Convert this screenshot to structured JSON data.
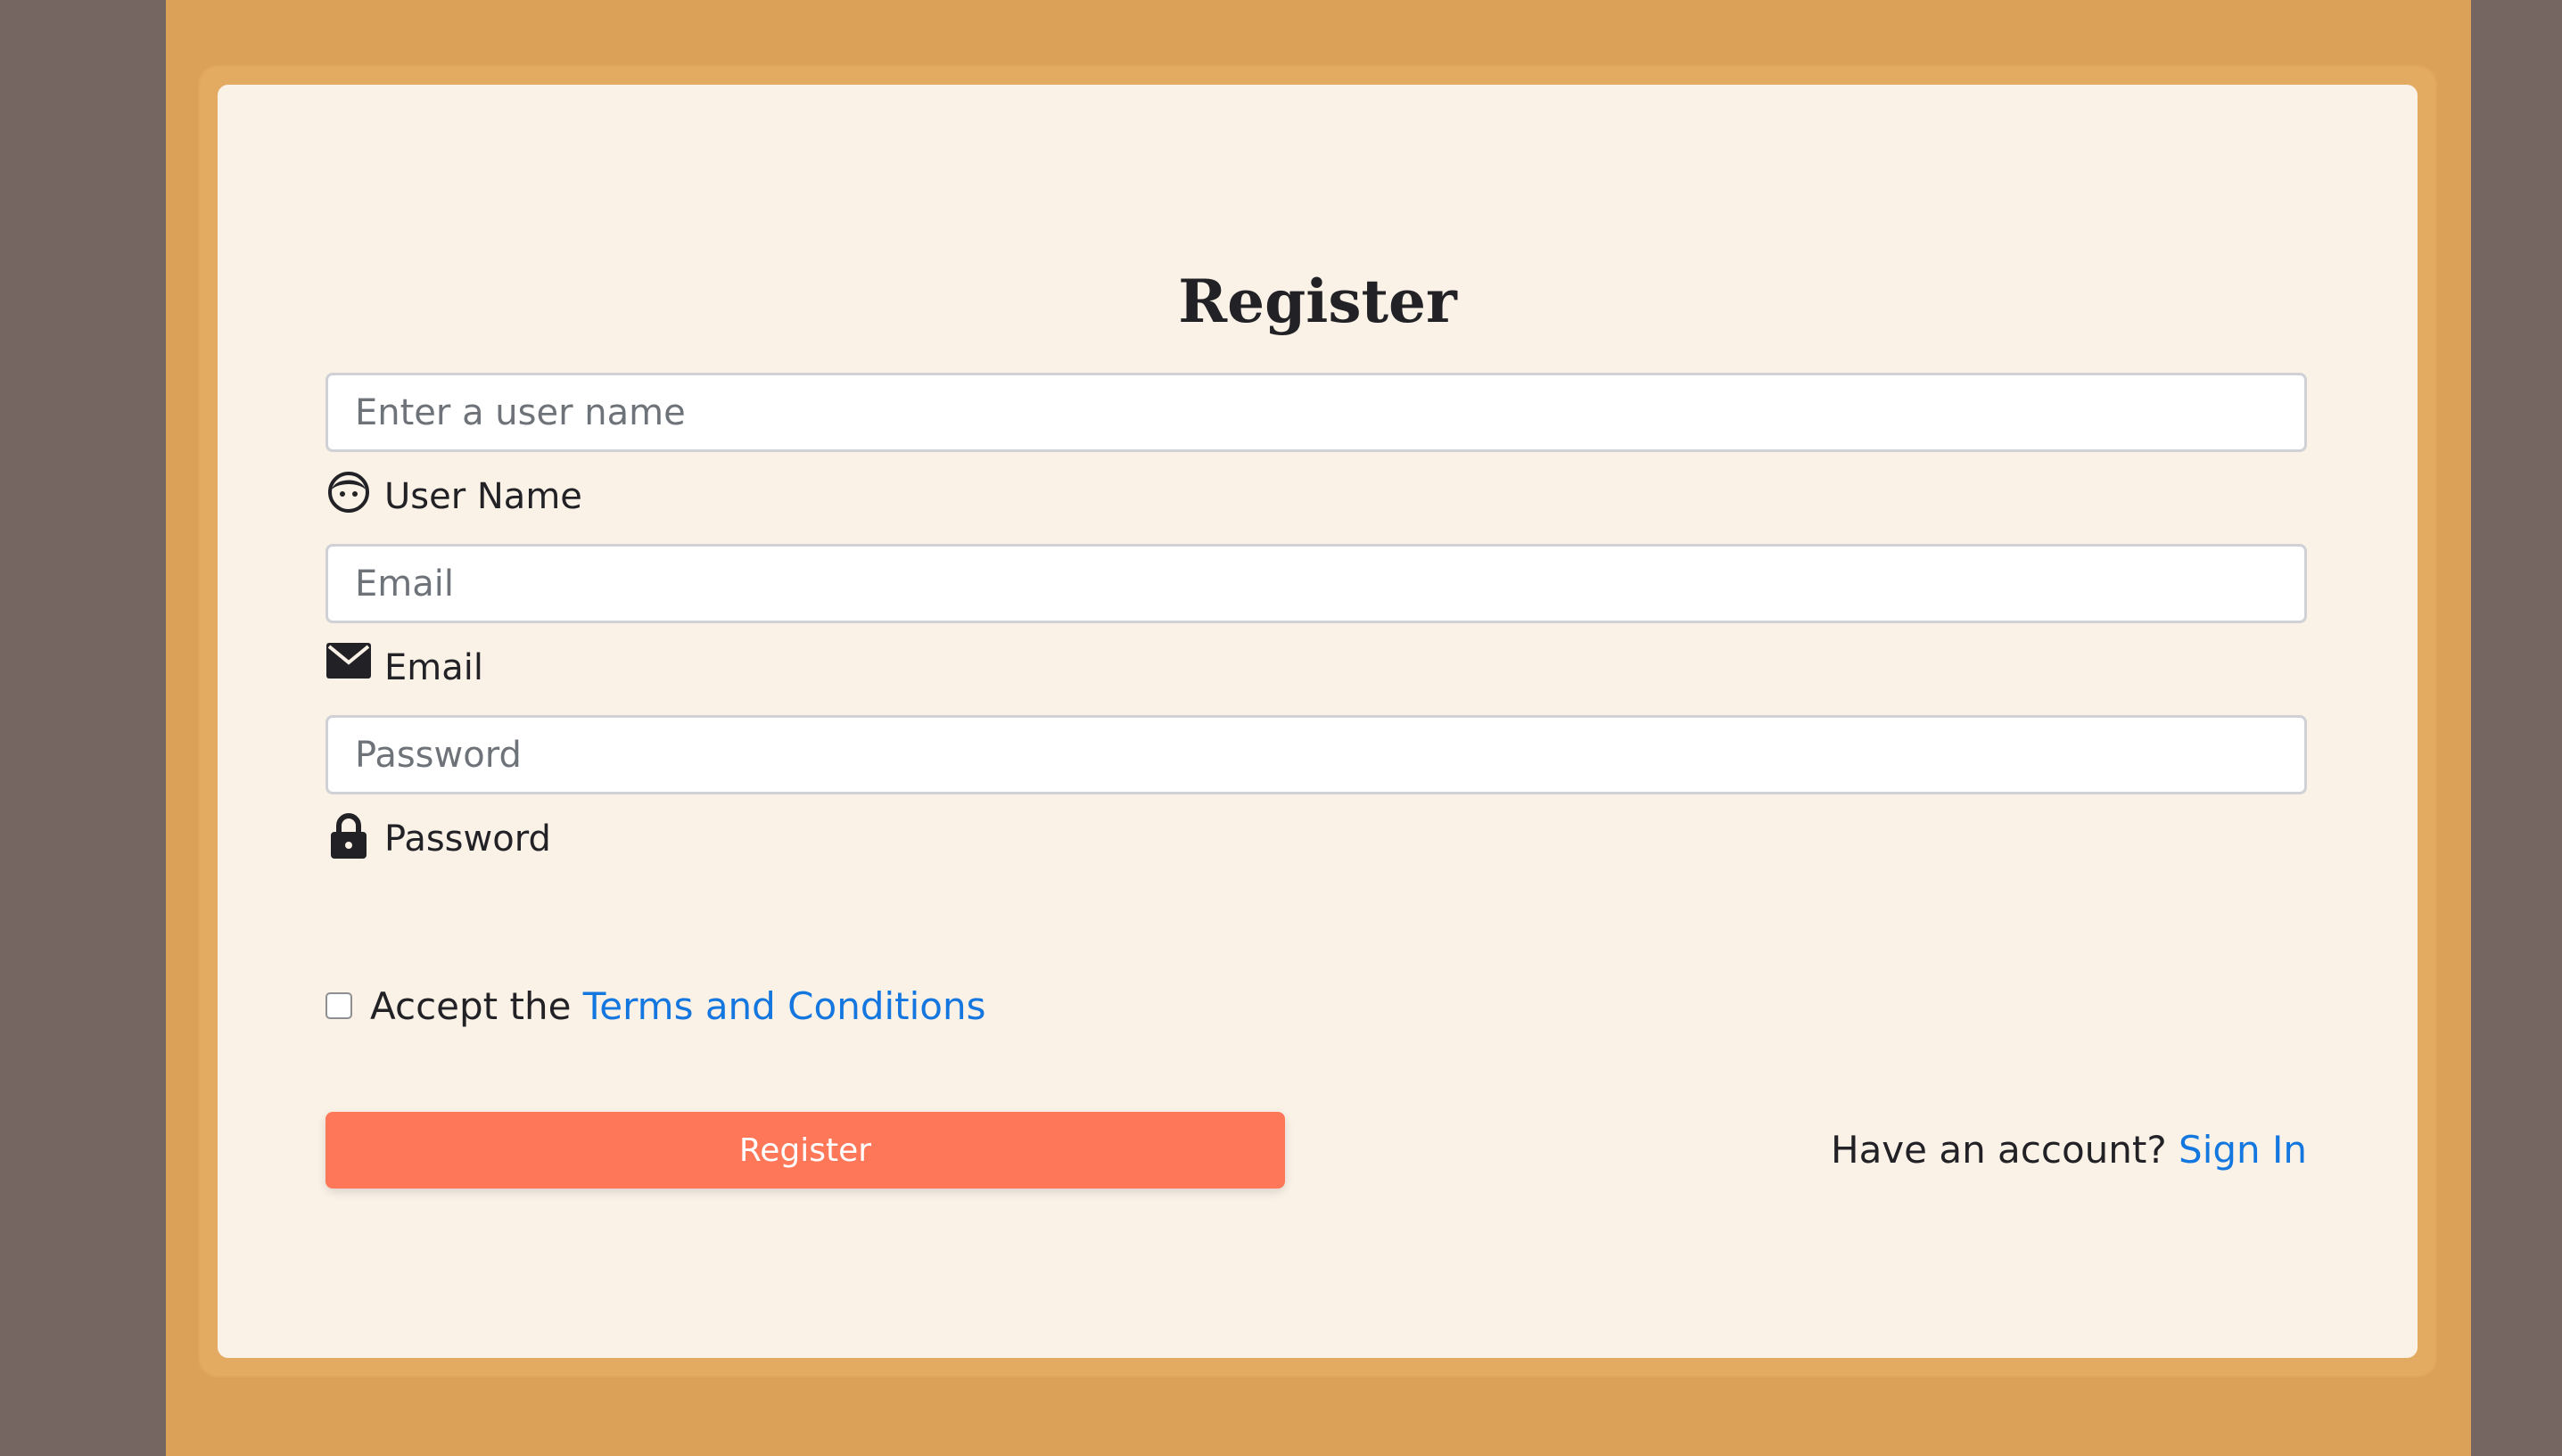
{
  "form": {
    "title": "Register",
    "username": {
      "placeholder": "Enter a user name",
      "value": "",
      "label": "User Name",
      "icon": "face-icon"
    },
    "email": {
      "placeholder": "Email",
      "value": "",
      "label": "Email",
      "icon": "envelope-icon"
    },
    "password": {
      "placeholder": "Password",
      "value": "",
      "label": "Password",
      "icon": "lock-icon"
    },
    "terms": {
      "prefix": "Accept the",
      "link_text": "Terms and Conditions",
      "checked": false
    },
    "submit_label": "Register",
    "signin": {
      "prompt": "Have an account?",
      "link_text": "Sign In"
    }
  },
  "colors": {
    "outer_background": "#766661",
    "band": "#dca158",
    "card": "#faf1e7",
    "button": "#ff7759",
    "link": "#1477e0"
  }
}
